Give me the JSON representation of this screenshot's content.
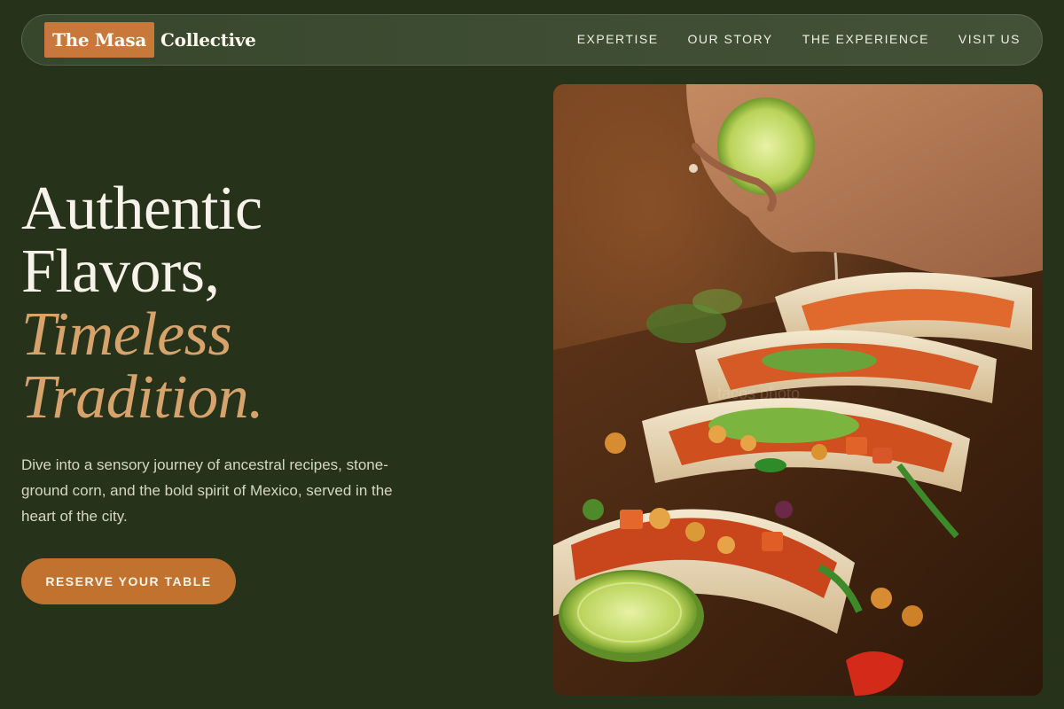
{
  "nav": {
    "logo_mark": "The Masa",
    "logo_text": "Collective",
    "links": [
      "EXPERTISE",
      "OUR STORY",
      "THE EXPERIENCE",
      "VISIT US"
    ]
  },
  "hero": {
    "title_line1": "Authentic",
    "title_line2": "Flavors,",
    "accent_line1": "Timeless",
    "accent_line2": "Tradition.",
    "description": "Dive into a sensory journey of ancestral recipes, stone-ground corn, and the bold spirit of Mexico, served in the heart of the city.",
    "cta_label": "RESERVE YOUR TABLE",
    "image_subject": "tacos-photo"
  },
  "colors": {
    "background": "#263219",
    "nav_background": "#3e4d33",
    "brand_accent": "#c7783a",
    "title_accent": "#d7a36c",
    "text": "#f7f3ea"
  }
}
